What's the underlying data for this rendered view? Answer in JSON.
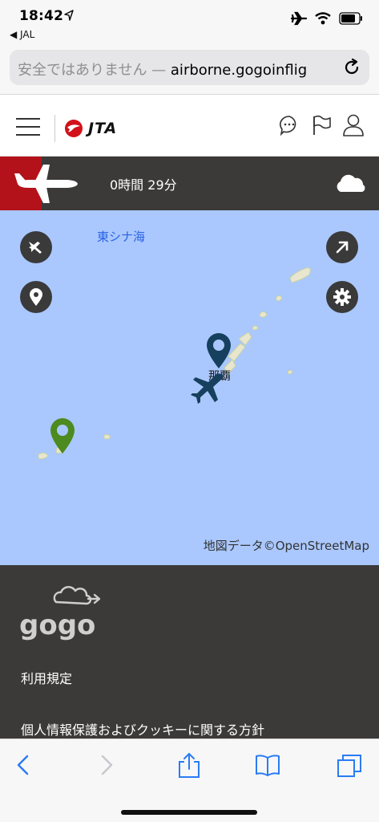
{
  "status_bar": {
    "time": "18:42",
    "back_app": "◀ JAL"
  },
  "browser": {
    "url_prefix": "安全ではありません — ",
    "url_host": "airborne.gogoinflig"
  },
  "header": {
    "logo_text": "JTA"
  },
  "flight": {
    "time_remaining": "0時間 29分"
  },
  "map": {
    "sea_label": "東シナ海",
    "city_label": "那覇",
    "attribution": "地図データ©OpenStreetMap",
    "colors": {
      "sea": "#aac8fe",
      "origin_pin": "#16405d",
      "destination_pin": "#4d8a1f",
      "plane": "#16405d"
    }
  },
  "footer": {
    "logo_text": "gogo",
    "links": [
      "利用規定",
      "個人情報保護およびクッキーに関する方針"
    ]
  },
  "colors": {
    "brand_red": "#b3121a",
    "bar_dark": "#3c3a39",
    "ios_blue": "#2a7bf5"
  }
}
